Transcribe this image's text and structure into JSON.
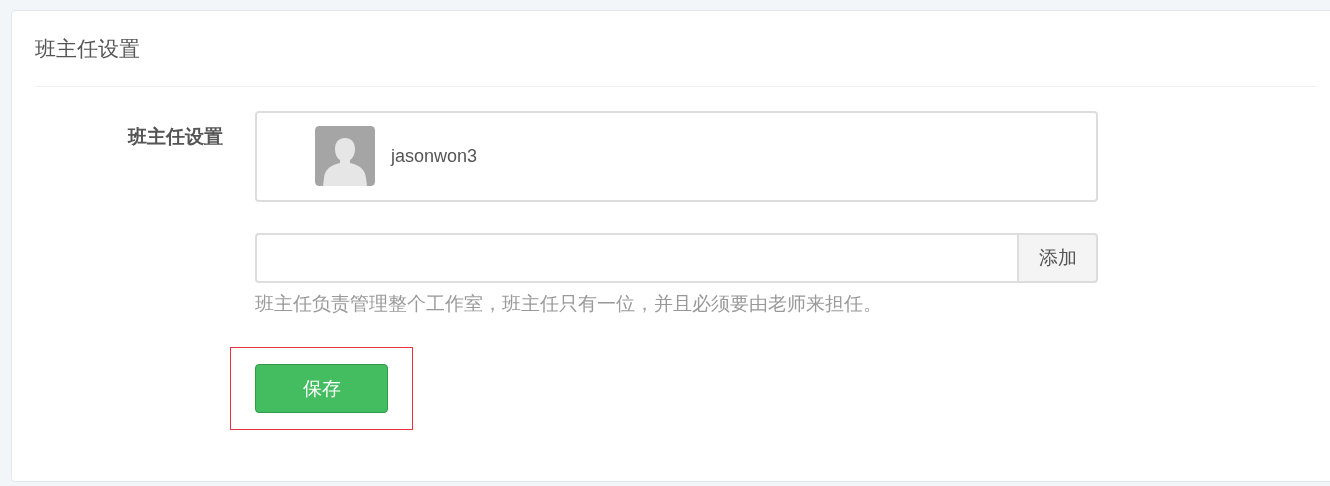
{
  "panel": {
    "title": "班主任设置"
  },
  "form": {
    "label": "班主任设置",
    "members": [
      {
        "name": "jasonwon3"
      }
    ],
    "add_field": {
      "button": "添加"
    },
    "help": "班主任负责管理整个工作室，班主任只有一位，并且必须要由老师来担任。",
    "save_button": "保存",
    "save_highlighted": true
  }
}
